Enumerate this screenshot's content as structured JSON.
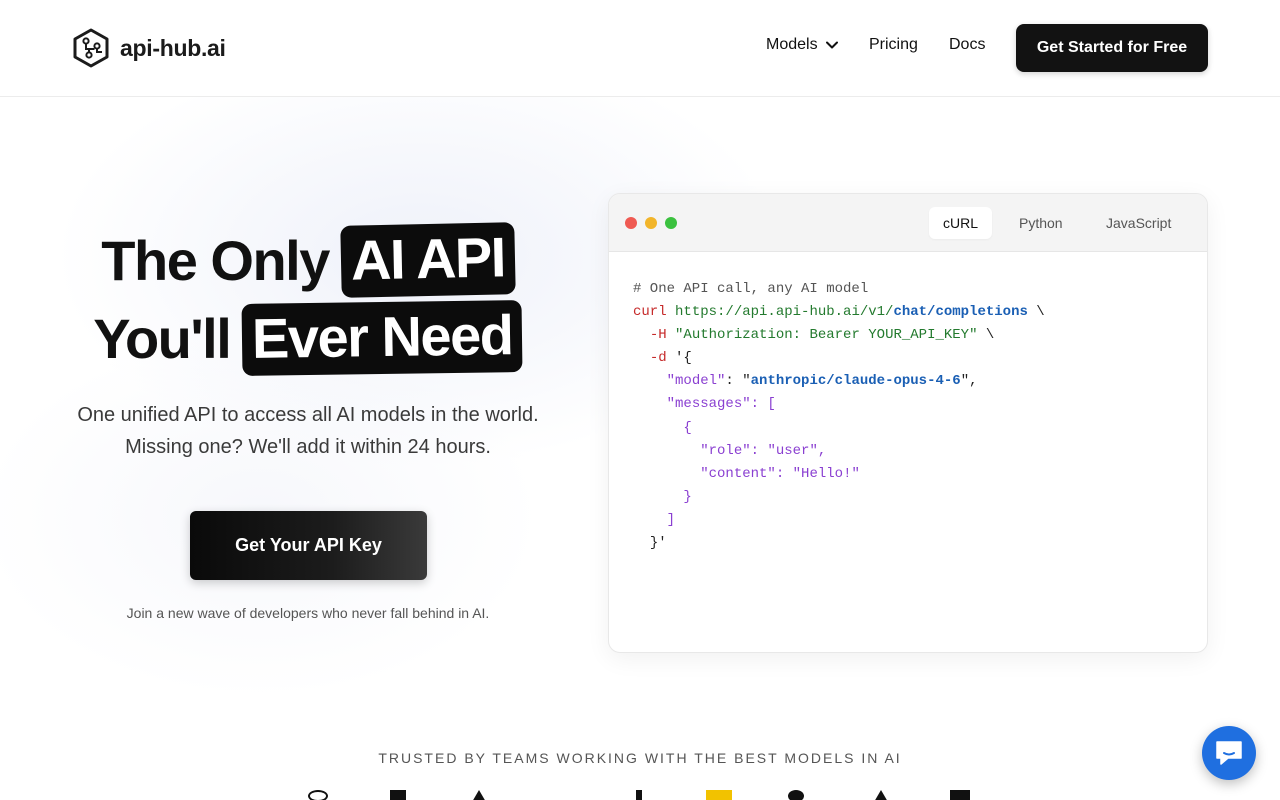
{
  "header": {
    "brand_name": "api-hub.ai",
    "nav": {
      "models": "Models",
      "pricing": "Pricing",
      "docs": "Docs"
    },
    "cta": "Get Started for Free"
  },
  "hero": {
    "line1_plain": "The Only",
    "line1_highlight": "AI API",
    "line2_plain": "You'll",
    "line2_highlight": "Ever Need",
    "subtitle_line1": "One unified API to access all AI models in the world.",
    "subtitle_line2": "Missing one? We'll add it within 24 hours.",
    "cta": "Get Your API Key",
    "note": "Join a new wave of developers who never fall behind in AI."
  },
  "code_card": {
    "tabs": [
      "cURL",
      "Python",
      "JavaScript"
    ],
    "active_tab": "cURL",
    "snippet": {
      "comment": "# One API call, any AI model",
      "curl_cmd": "curl",
      "url_prefix": "https://api.api-hub.ai/v1/",
      "url_path": "chat/completions",
      "continuation": "\\",
      "header_flag": "-H",
      "header_value": "\"Authorization: Bearer YOUR_API_KEY\"",
      "data_flag": "-d",
      "data_open": "'{",
      "model_key": "\"model\"",
      "model_value": "anthropic/claude-opus-4-6",
      "messages_key": "\"messages\"",
      "role_key": "\"role\"",
      "role_value": "\"user\"",
      "content_key": "\"content\"",
      "content_value": "\"Hello!\"",
      "data_close": "}'"
    }
  },
  "trusted": {
    "label": "TRUSTED BY TEAMS WORKING WITH THE BEST MODELS IN AI"
  },
  "colors": {
    "primary_dark": "#121212",
    "chat_blue": "#1f6fe0",
    "code_red": "#c62a2a",
    "code_green": "#237a2e",
    "code_blue": "#1a5fb4",
    "code_purple": "#8a3fd1"
  },
  "icons": {
    "brand_logo": "hexagon-circuit-icon",
    "models_dropdown": "chevron-down-icon",
    "chat_widget": "chat-bubble-icon"
  }
}
